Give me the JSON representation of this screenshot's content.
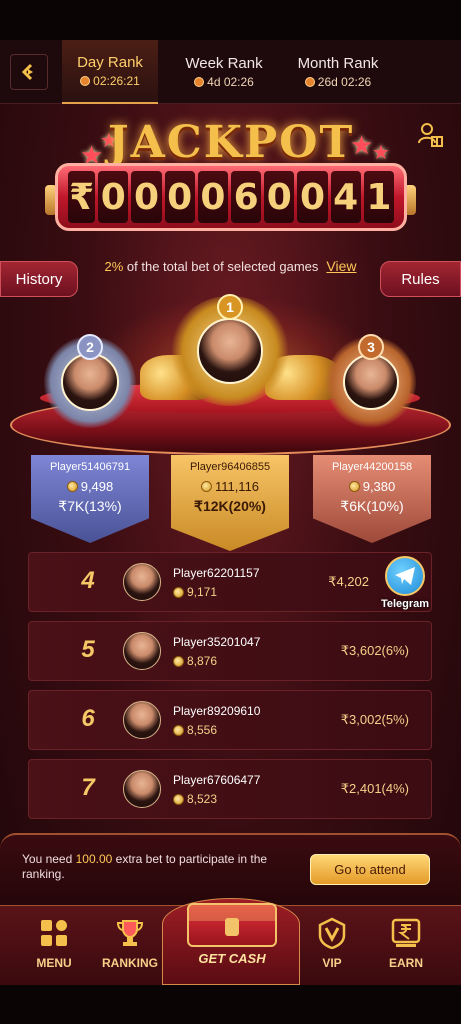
{
  "header": {
    "tabs": [
      {
        "label": "Day Rank",
        "timer": "02:26:21",
        "active": true
      },
      {
        "label": "Week Rank",
        "timer": "4d 02:26",
        "active": false
      },
      {
        "label": "Month Rank",
        "timer": "26d 02:26",
        "active": false
      }
    ]
  },
  "jackpot": {
    "title": "JACKPOT",
    "currency": "₹",
    "digits": [
      "0",
      "0",
      "0",
      "0",
      "6",
      "0",
      "0",
      "4",
      "1"
    ]
  },
  "info": {
    "percent": "2%",
    "text": " of the total bet of selected games",
    "view_label": "View"
  },
  "buttons": {
    "history": "History",
    "rules": "Rules"
  },
  "top3": [
    {
      "rank": "2",
      "name": "Player51406791",
      "score": "9,498",
      "reward": "₹7K(13%)"
    },
    {
      "rank": "1",
      "name": "Player96406855",
      "score": "111,116",
      "reward": "₹12K(20%)"
    },
    {
      "rank": "3",
      "name": "Player44200158",
      "score": "9,380",
      "reward": "₹6K(10%)"
    }
  ],
  "rows": [
    {
      "rank": "4",
      "name": "Player62201157",
      "score": "9,171",
      "reward": "₹4,202"
    },
    {
      "rank": "5",
      "name": "Player35201047",
      "score": "8,876",
      "reward": "₹3,602(6%)"
    },
    {
      "rank": "6",
      "name": "Player89209610",
      "score": "8,556",
      "reward": "₹3,002(5%)"
    },
    {
      "rank": "7",
      "name": "Player67606477",
      "score": "8,523",
      "reward": "₹2,401(4%)"
    }
  ],
  "telegram": {
    "label": "Telegram"
  },
  "notice": {
    "prefix": "You need ",
    "amount": "100.00",
    "suffix": " extra bet to participate in the ranking.",
    "button": "Go to attend"
  },
  "nav": {
    "menu": "MENU",
    "ranking": "RANKING",
    "getcash": "GET CASH",
    "vip": "VIP",
    "earn": "EARN"
  },
  "colors": {
    "accent_gold": "#ffc857",
    "brand_red": "#c0172a",
    "background": "#3a0d12"
  },
  "icons": [
    "back-arrow-icon",
    "clock-icon",
    "user-gift-icon",
    "coin-icon",
    "telegram-icon",
    "menu-grid-icon",
    "trophy-icon",
    "treasure-chest-icon",
    "vip-badge-icon",
    "rupee-icon"
  ]
}
